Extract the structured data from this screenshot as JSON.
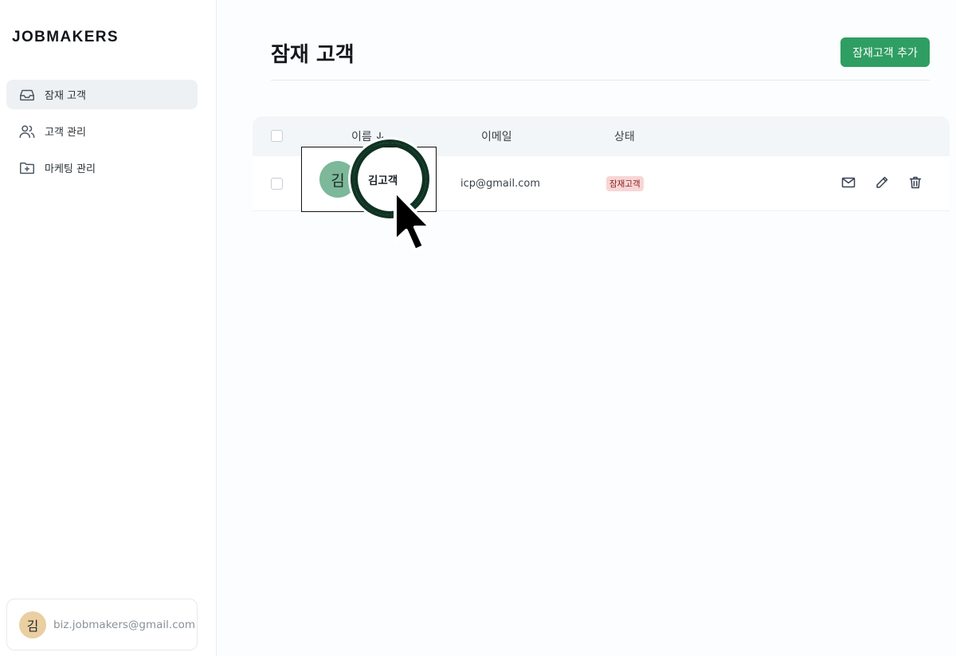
{
  "brand": {
    "logo_text": "JOBMAKERS"
  },
  "sidebar": {
    "items": [
      {
        "label": "잠재 고객",
        "icon": "inbox-icon",
        "active": true
      },
      {
        "label": "고객 관리",
        "icon": "users-icon",
        "active": false
      },
      {
        "label": "마케팅 관리",
        "icon": "folder-plus-icon",
        "active": false
      }
    ],
    "account": {
      "avatar_initial": "김",
      "email": "biz.jobmakers@gmail.com"
    }
  },
  "page": {
    "title": "잠재 고객",
    "add_button_label": "잠재고객 추가"
  },
  "table": {
    "columns": {
      "name": "이름",
      "email": "이메일",
      "status": "상태"
    },
    "rows": [
      {
        "avatar_initial": "김",
        "name": "김고객",
        "email": "icp@gmail.com",
        "status": "잠재고객"
      }
    ]
  },
  "colors": {
    "accent_green": "#2f9e62",
    "avatar_green": "#7cb899",
    "avatar_tan": "#e9cfa2",
    "status_bg": "#f7d6d6",
    "status_text": "#8b1c1c"
  }
}
